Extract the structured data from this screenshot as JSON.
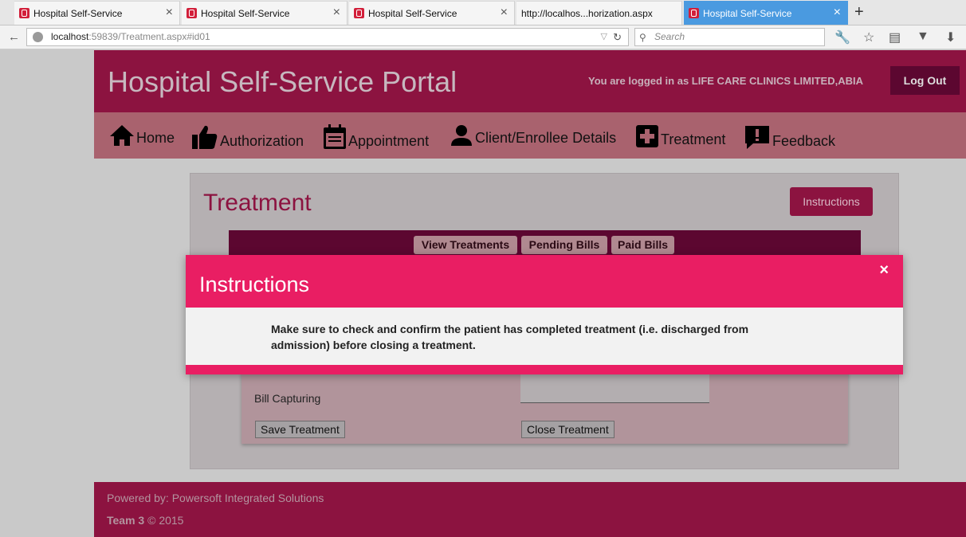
{
  "browser": {
    "tabs": [
      {
        "title": "Hospital Self-Service",
        "active": false
      },
      {
        "title": "Hospital Self-Service",
        "active": false
      },
      {
        "title": "Hospital Self-Service",
        "active": false
      },
      {
        "title": "http://localhos...horization.aspx",
        "active": false
      },
      {
        "title": "Hospital Self-Service",
        "active": true
      }
    ],
    "url_host": "localhost",
    "url_rest": ":59839/Treatment.aspx#id01",
    "search_placeholder": "Search"
  },
  "header": {
    "portal_title": "Hospital Self-Service Portal",
    "logged_in_text": "You are logged in as LIFE CARE CLINICS LIMITED,ABIA",
    "logout_label": "Log Out"
  },
  "menu": {
    "items": [
      "Home",
      "Authorization",
      "Appointment",
      "Client/Enrollee Details",
      "Treatment",
      "Feedback"
    ]
  },
  "panel": {
    "title": "Treatment",
    "instructions_label": "Instructions",
    "subtabs": [
      "View Treatments",
      "Pending Bills",
      "Paid Bills"
    ],
    "form": {
      "bill_capturing_label": "Bill Capturing",
      "save_label": "Save Treatment",
      "close_label": "Close Treatment"
    }
  },
  "footer": {
    "powered_by": "Powered by: Powersoft Integrated Solutions",
    "team": "Team 3",
    "copyright": " © 2015"
  },
  "modal": {
    "title": "Instructions",
    "close_symbol": "×",
    "body": "Make sure to check and confirm the patient has completed treatment (i.e. discharged from admission) before closing a treatment."
  },
  "colors": {
    "brand": "#8c1340",
    "modal_accent": "#e91e63",
    "active_tab": "#4a9ae0"
  }
}
